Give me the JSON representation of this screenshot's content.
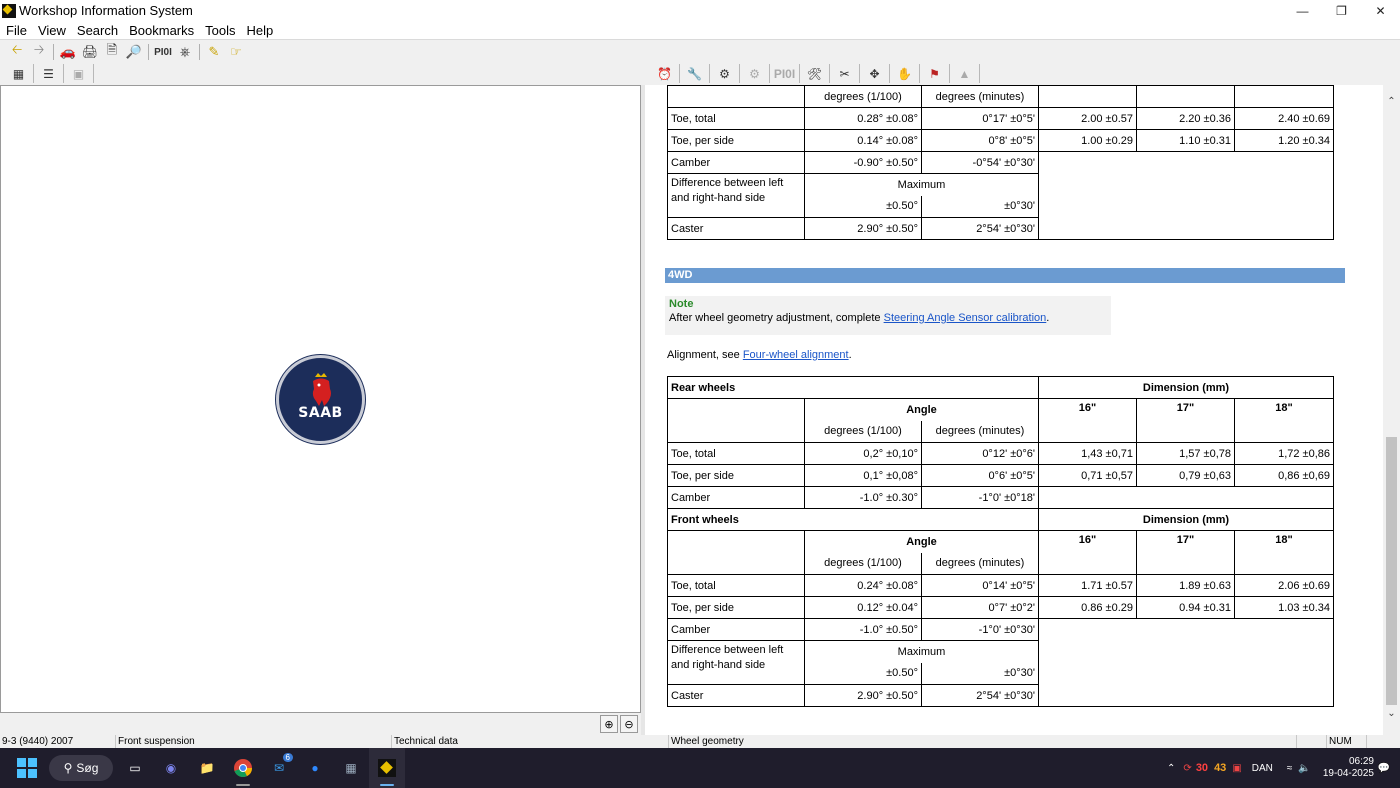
{
  "window": {
    "title": "Workshop Information System"
  },
  "menu": [
    "File",
    "View",
    "Search",
    "Bookmarks",
    "Tools",
    "Help"
  ],
  "toolbar": {
    "pio_label": "PI0I",
    "pio2_label": "PI0I"
  },
  "top_table": {
    "header_deg100": "degrees (1/100)",
    "header_degmin": "degrees (minutes)",
    "rows": [
      {
        "label": "Toe, total",
        "d100": "0.28° ±0.08°",
        "dmin": "0°17' ±0°5'",
        "c16": "2.00 ±0.57",
        "c17": "2.20 ±0.36",
        "c18": "2.40 ±0.69"
      },
      {
        "label": "Toe, per side",
        "d100": "0.14° ±0.08°",
        "dmin": "0°8' ±0°5'",
        "c16": "1.00 ±0.29",
        "c17": "1.10 ±0.31",
        "c18": "1.20 ±0.34"
      },
      {
        "label": "Camber",
        "d100": "-0.90° ±0.50°",
        "dmin": "-0°54' ±0°30'"
      }
    ],
    "diff_label_1": "Difference between left",
    "diff_label_2": "and right-hand side",
    "maximum": "Maximum",
    "diff_d100": "±0.50°",
    "diff_dmin": "±0°30'",
    "caster_label": "Caster",
    "caster_d100": "2.90° ±0.50°",
    "caster_dmin": "2°54' ±0°30'"
  },
  "section": {
    "title": "4WD"
  },
  "note": {
    "title": "Note",
    "text_before": "After wheel geometry adjustment, complete ",
    "link": "Steering Angle Sensor calibration",
    "text_after": "."
  },
  "alignment": {
    "text_before": "Alignment, see ",
    "link": "Four-wheel alignment",
    "text_after": "."
  },
  "rear_table": {
    "title": "Rear wheels",
    "dimension": "Dimension (mm)",
    "angle": "Angle",
    "s16": "16\"",
    "s17": "17\"",
    "s18": "18\"",
    "header_deg100": "degrees (1/100)",
    "header_degmin": "degrees (minutes)",
    "rows": [
      {
        "label": "Toe, total",
        "d100": "0,2° ±0,10°",
        "dmin": "0°12' ±0°6'",
        "c16": "1,43 ±0,71",
        "c17": "1,57 ±0,78",
        "c18": "1,72 ±0,86"
      },
      {
        "label": "Toe, per side",
        "d100": "0,1° ±0,08°",
        "dmin": "0°6' ±0°5'",
        "c16": "0,71 ±0,57",
        "c17": "0,79 ±0,63",
        "c18": "0,86 ±0,69"
      },
      {
        "label": "Camber",
        "d100": "-1.0° ±0.30°",
        "dmin": "-1°0' ±0°18'"
      }
    ]
  },
  "front_table": {
    "title": "Front wheels",
    "dimension": "Dimension (mm)",
    "angle": "Angle",
    "s16": "16\"",
    "s17": "17\"",
    "s18": "18\"",
    "header_deg100": "degrees (1/100)",
    "header_degmin": "degrees (minutes)",
    "rows": [
      {
        "label": "Toe, total",
        "d100": "0.24° ±0.08°",
        "dmin": "0°14' ±0°5'",
        "c16": "1.71 ±0.57",
        "c17": "1.89 ±0.63",
        "c18": "2.06 ±0.69"
      },
      {
        "label": "Toe, per side",
        "d100": "0.12° ±0.04°",
        "dmin": "0°7' ±0°2'",
        "c16": "0.86 ±0.29",
        "c17": "0.94 ±0.31",
        "c18": "1.03 ±0.34"
      },
      {
        "label": "Camber",
        "d100": "-1.0° ±0.50°",
        "dmin": "-1°0' ±0°30'"
      }
    ],
    "diff_label_1": "Difference between left",
    "diff_label_2": "and right-hand side",
    "maximum": "Maximum",
    "diff_d100": "±0.50°",
    "diff_dmin": "±0°30'",
    "caster_label": "Caster",
    "caster_d100": "2.90° ±0.50°",
    "caster_dmin": "2°54' ±0°30'"
  },
  "logo": {
    "text": "SAAB"
  },
  "status": {
    "model": "9-3 (9440) 2007",
    "group": "Front suspension",
    "section": "Technical data",
    "doc": "Wheel geometry",
    "num": "NUM"
  },
  "taskbar": {
    "search": "Søg",
    "mail_badge": "6",
    "tray_num1": "30",
    "tray_num2": "43",
    "lang": "DAN",
    "time": "06:29",
    "date": "19-04-2025"
  },
  "colors": {
    "section_bar": "#6b9bd1",
    "note_title": "#2a8a2a",
    "link": "#1a55c8",
    "taskbar": "#1f1d2c"
  }
}
